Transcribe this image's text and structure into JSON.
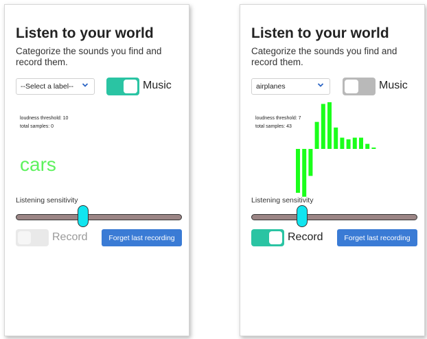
{
  "colors": {
    "accent_toggle": "#2ac4a3",
    "toggle_off": "#b9b9b9",
    "button": "#3a7bd5",
    "bars": "#1bff1b",
    "cars_text": "#5ef25e",
    "slider_thumb": "#11e5ef",
    "slider_track": "#9b8585"
  },
  "left": {
    "title": "Listen to your world",
    "subtitle": "Categorize the sounds you find and record them.",
    "select_value": "--Select a label--",
    "music_toggle": {
      "label": "Music",
      "on": true
    },
    "stats": {
      "threshold": "loudness threshold: 10",
      "samples": "total samples: 0"
    },
    "detected_label": "cars",
    "sensitivity_label": "Listening sensitivity",
    "sensitivity_value": 0.4,
    "record_toggle": {
      "label": "Record",
      "on": false
    },
    "forget_label": "Forget last recording"
  },
  "right": {
    "title": "Listen to your world",
    "subtitle": "Categorize the sounds you find and record them.",
    "select_value": "airplanes",
    "music_toggle": {
      "label": "Music",
      "on": false
    },
    "stats": {
      "threshold": "loudness threshold: 7",
      "samples": "total samples: 43"
    },
    "sensitivity_label": "Listening sensitivity",
    "sensitivity_value": 0.29,
    "record_toggle": {
      "label": "Record",
      "on": true
    },
    "forget_label": "Forget last recording",
    "sound_bars": [
      -0.78,
      -0.85,
      -0.48,
      0.48,
      0.8,
      0.83,
      0.38,
      0.2,
      0.17,
      0.2,
      0.2,
      0.09,
      0.02
    ]
  }
}
